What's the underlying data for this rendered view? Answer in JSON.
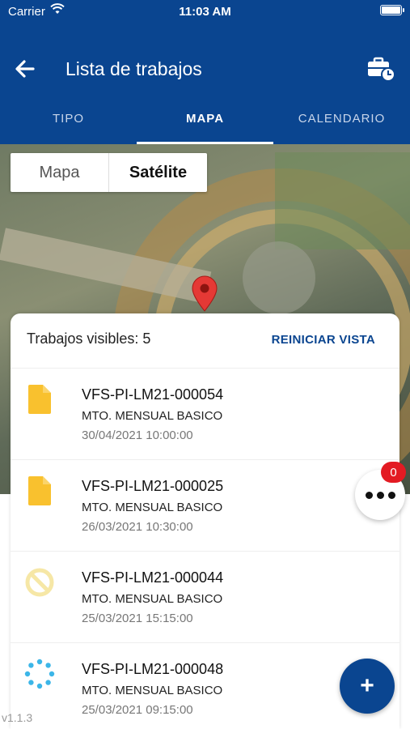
{
  "status_bar": {
    "carrier": "Carrier",
    "time": "11:03 AM"
  },
  "header": {
    "title": "Lista de trabajos",
    "back_icon": "arrow-left-icon",
    "tools_icon": "toolbox-clock-icon"
  },
  "tabs": [
    {
      "label": "TIPO",
      "active": false
    },
    {
      "label": "MAPA",
      "active": true
    },
    {
      "label": "CALENDARIO",
      "active": false
    }
  ],
  "map": {
    "toggle": {
      "map_label": "Mapa",
      "satellite_label": "Satélite",
      "selected": "Satélite"
    }
  },
  "sheet": {
    "visible_jobs": "Trabajos visibles: 5",
    "reset_label": "REINICIAR VISTA",
    "jobs": [
      {
        "code": "VFS-PI-LM21-000054",
        "description": "MTO. MENSUAL BASICO",
        "date": "30/04/2021 10:00:00",
        "icon": "document-icon"
      },
      {
        "code": "VFS-PI-LM21-000025",
        "description": "MTO. MENSUAL BASICO",
        "date": "26/03/2021 10:30:00",
        "icon": "document-icon"
      },
      {
        "code": "VFS-PI-LM21-000044",
        "description": "MTO. MENSUAL BASICO",
        "date": "25/03/2021 15:15:00",
        "icon": "cancelled-icon"
      },
      {
        "code": "VFS-PI-LM21-000048",
        "description": "MTO. MENSUAL BASICO",
        "date": "25/03/2021 09:15:00",
        "icon": "in-progress-icon"
      }
    ]
  },
  "more_button": {
    "badge": "0"
  },
  "fab": {
    "label": "+"
  },
  "version": "v1.1.3",
  "colors": {
    "primary": "#0a4590",
    "document": "#f9c12e",
    "cancelled": "#f6e7a6",
    "in_progress": "#3cb6e8",
    "badge": "#e31b23"
  }
}
